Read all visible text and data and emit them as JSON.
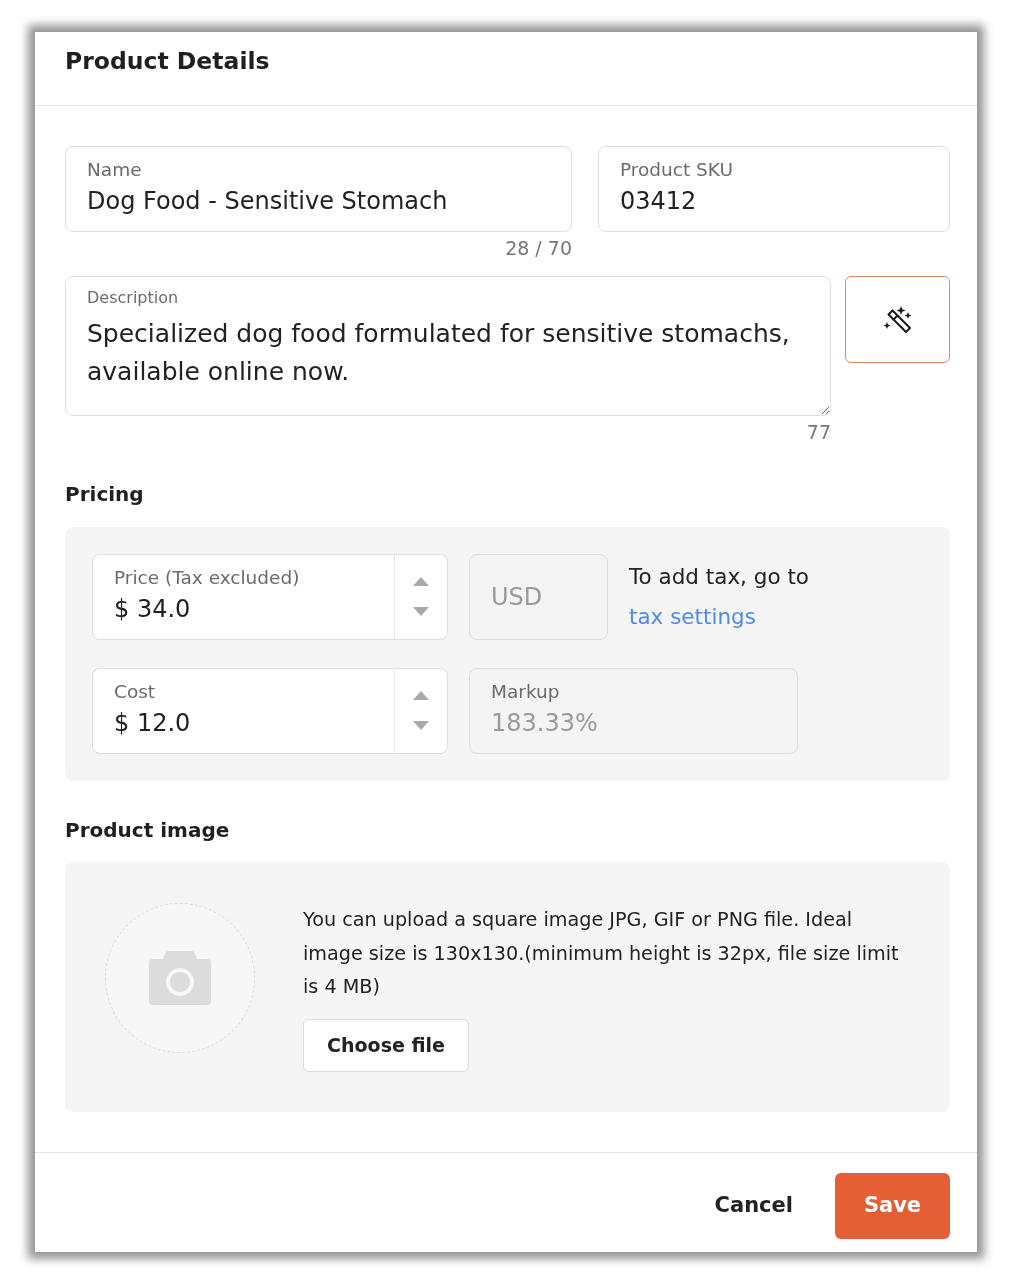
{
  "dialog": {
    "title": "Product Details"
  },
  "details": {
    "fields": [
      {
        "kind": "text",
        "label": "Name",
        "value": "Dog Food - Sensitive Stomach",
        "counter": "28 / 70"
      },
      {
        "kind": "text",
        "label": "Product SKU",
        "value": "03412"
      }
    ],
    "description": {
      "label": "Description",
      "value": "Specialized dog food formulated for sensitive stomachs, available online now.",
      "counter": "77"
    }
  },
  "pricing": {
    "title": "Pricing",
    "rows": [
      [
        {
          "kind": "stepper",
          "label": "Price (Tax excluded)",
          "value": "$ 34.0",
          "disabled": false
        },
        {
          "kind": "field",
          "value": "USD",
          "disabled": true
        },
        {
          "kind": "note",
          "text": "To add tax, go to",
          "link": "tax settings"
        }
      ],
      [
        {
          "kind": "stepper",
          "label": "Cost",
          "value": "$ 12.0",
          "disabled": false
        },
        {
          "kind": "field",
          "label": "Markup",
          "value": "183.33%",
          "disabled": true
        }
      ]
    ]
  },
  "product_image": {
    "title": "Product image",
    "hint": "You can upload a square image JPG, GIF or PNG file. Ideal image size is 130x130.(minimum height is 32px, file size limit is 4 MB)",
    "button": "Choose file"
  },
  "actions": [
    {
      "kind": "link",
      "label": "Cancel"
    },
    {
      "kind": "primary",
      "label": "Save"
    }
  ]
}
